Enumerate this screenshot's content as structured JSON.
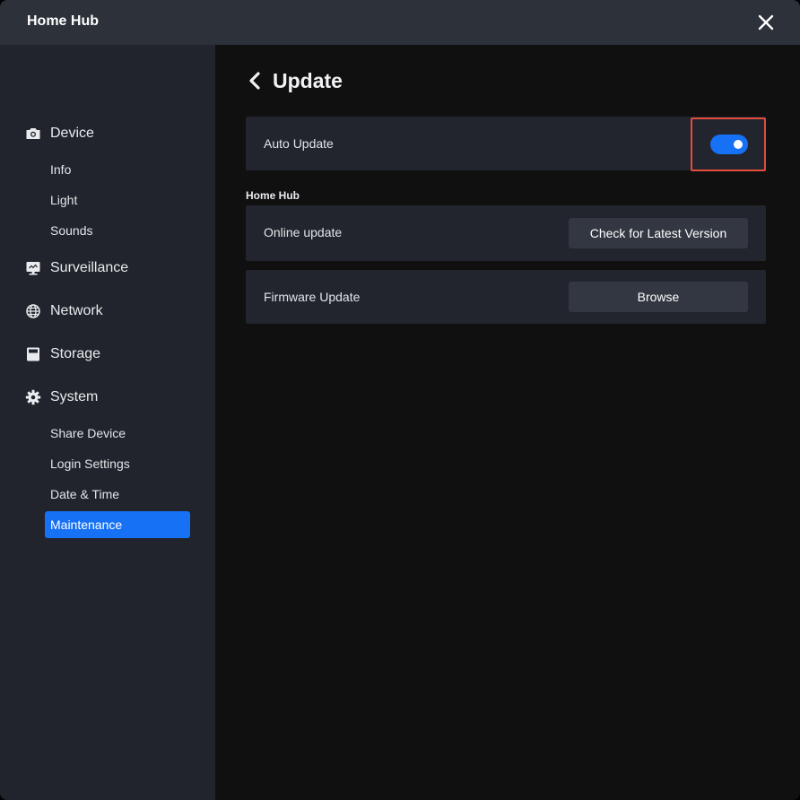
{
  "app": {
    "title": "Home Hub"
  },
  "sidebar": {
    "groups": [
      {
        "label": "Device",
        "icon": "camera-icon",
        "items": [
          "Info",
          "Light",
          "Sounds"
        ]
      },
      {
        "label": "Surveillance",
        "icon": "monitor-icon",
        "items": []
      },
      {
        "label": "Network",
        "icon": "globe-icon",
        "items": []
      },
      {
        "label": "Storage",
        "icon": "storage-icon",
        "items": []
      },
      {
        "label": "System",
        "icon": "gear-icon",
        "items": [
          "Share Device",
          "Login Settings",
          "Date & Time",
          "Maintenance"
        ]
      }
    ],
    "active_item": "Maintenance"
  },
  "page": {
    "title": "Update",
    "auto_update": {
      "label": "Auto Update",
      "enabled": true
    },
    "section_label": "Home Hub",
    "online_update": {
      "label": "Online update",
      "button": "Check for Latest Version"
    },
    "firmware_update": {
      "label": "Firmware Update",
      "button": "Browse"
    }
  },
  "colors": {
    "accent": "#1671f5",
    "highlight_border": "#e14c3d",
    "sidebar_bg": "#21242c",
    "content_bg": "#101011",
    "titlebar_bg": "#2c313a"
  }
}
